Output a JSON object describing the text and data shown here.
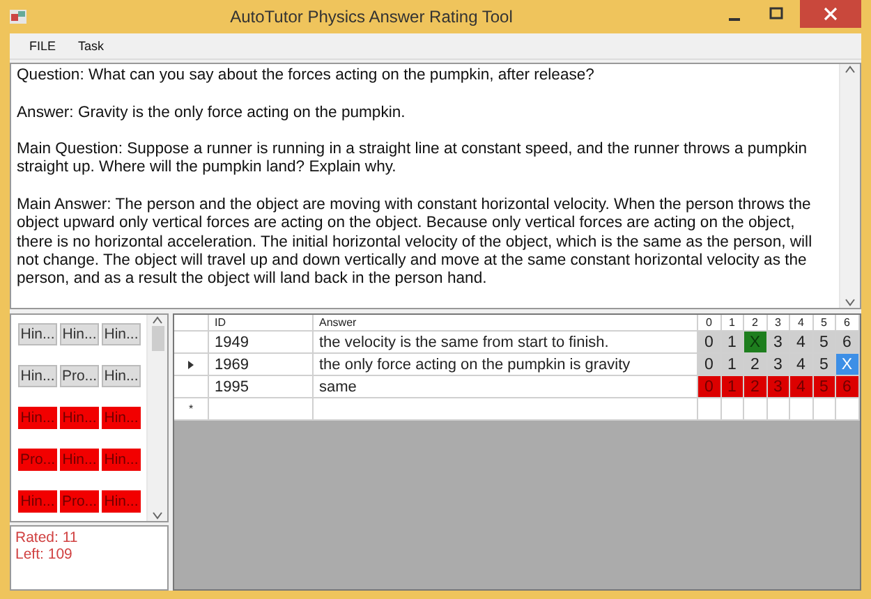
{
  "window": {
    "title": "AutoTutor Physics Answer Rating Tool"
  },
  "menu": [
    "FILE",
    "Task"
  ],
  "details": [
    "Question: What can you say about the forces acting on the pumpkin, after release?",
    "Answer: Gravity is the only force acting on the pumpkin.",
    "Main Question: Suppose a runner is running in a straight line at constant speed,  and the runner throws a pumpkin straight up. Where will the pumpkin land? Explain why.",
    "Main Answer: The person and the object are moving with constant horizontal velocity. When the person throws the object upward only vertical forces are acting on the object. Because only vertical forces are acting on the object, there is no horizontal acceleration. The initial horizontal velocity of the object, which is the same as the person, will not change. The object will travel up and down vertically and move at the same constant horizontal velocity as the person, and as a result the object will land back in the person hand."
  ],
  "items": [
    {
      "label": "Hin...",
      "rated": true
    },
    {
      "label": "Hin...",
      "rated": true
    },
    {
      "label": "Hin...",
      "rated": true
    },
    {
      "label": "Hin...",
      "rated": true
    },
    {
      "label": "Pro...",
      "rated": true
    },
    {
      "label": "Hin...",
      "rated": true
    },
    {
      "label": "Hin...",
      "rated": false
    },
    {
      "label": "Hin...",
      "rated": false
    },
    {
      "label": "Hin...",
      "rated": false
    },
    {
      "label": "Pro...",
      "rated": false
    },
    {
      "label": "Hin...",
      "rated": false
    },
    {
      "label": "Hin...",
      "rated": false
    },
    {
      "label": "Hin...",
      "rated": false
    },
    {
      "label": "Pro...",
      "rated": false
    },
    {
      "label": "Hin...",
      "rated": false
    }
  ],
  "stats": [
    "Rated: 11",
    "Left:  109"
  ],
  "table": {
    "columns": [
      "ID",
      "Answer",
      "0",
      "1",
      "2",
      "3",
      "4",
      "5",
      "6"
    ],
    "rows": [
      {
        "id": "1949",
        "answer": "the velocity is the same from start to finish.",
        "rated": true,
        "selected": false,
        "scores": [
          {
            "label": "0",
            "selected": false
          },
          {
            "label": "1",
            "selected": false
          },
          {
            "label": "X",
            "selected": true
          },
          {
            "label": "3",
            "selected": false
          },
          {
            "label": "4",
            "selected": false
          },
          {
            "label": "5",
            "selected": false
          },
          {
            "label": "6",
            "selected": false
          }
        ]
      },
      {
        "id": "1969",
        "answer": "the only force acting on the pumpkin is gravity",
        "rated": true,
        "selected": true,
        "scores": [
          {
            "label": "0",
            "selected": false
          },
          {
            "label": "1",
            "selected": false
          },
          {
            "label": "2",
            "selected": false
          },
          {
            "label": "3",
            "selected": false
          },
          {
            "label": "4",
            "selected": false
          },
          {
            "label": "5",
            "selected": false
          },
          {
            "label": "X",
            "selected": true
          }
        ]
      },
      {
        "id": "1995",
        "answer": "same",
        "rated": false,
        "selected": false,
        "scores": [
          {
            "label": "0"
          },
          {
            "label": "1"
          },
          {
            "label": "2"
          },
          {
            "label": "3"
          },
          {
            "label": "4"
          },
          {
            "label": "5"
          },
          {
            "label": "6"
          }
        ]
      }
    ],
    "new_row_marker": "*"
  }
}
